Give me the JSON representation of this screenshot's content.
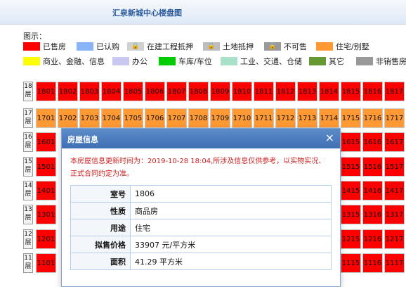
{
  "page_title": "汇泉新城中心楼盘图",
  "legend_label": "图示：",
  "legend": [
    {
      "label": "已售房",
      "color": "#ff0000",
      "icon": ""
    },
    {
      "label": "已认购",
      "color": "#8ab4f8",
      "icon": ""
    },
    {
      "label": "在建工程抵押",
      "color": "#d0d0d0",
      "icon": "lock-icon"
    },
    {
      "label": "土地抵押",
      "color": "#bdbdbd",
      "icon": "lock-icon"
    },
    {
      "label": "不可售",
      "color": "#9a9a9a",
      "icon": "lock-icon"
    },
    {
      "label": "住宅/别墅",
      "color": "#ff9933",
      "icon": ""
    },
    {
      "label": "商业、金融、信息",
      "color": "#ffff00",
      "icon": ""
    },
    {
      "label": "办公",
      "color": "#c8c8f0",
      "icon": ""
    },
    {
      "label": "车库/车位",
      "color": "#00cc00",
      "icon": ""
    },
    {
      "label": "工业、交通、仓储",
      "color": "#a8e0c8",
      "icon": ""
    },
    {
      "label": "其它",
      "color": "#669933",
      "icon": ""
    },
    {
      "label": "非销售房",
      "color": "#999999",
      "icon": ""
    }
  ],
  "floors": [
    {
      "label": "18层",
      "status": "sold",
      "units": [
        "1801",
        "1802",
        "1803",
        "1804",
        "1805",
        "1806",
        "1807",
        "1808",
        "1809",
        "1810",
        "1811",
        "1812",
        "1813",
        "1814",
        "1815",
        "1816",
        "1817"
      ]
    },
    {
      "label": "17层",
      "status": "home",
      "units": [
        "1701",
        "1702",
        "1703",
        "1704",
        "1705",
        "1706",
        "1707",
        "1708",
        "1709",
        "1710",
        "1711",
        "1712",
        "1713",
        "1714",
        "1715",
        "1716",
        "1717"
      ]
    },
    {
      "label": "16层",
      "status": "sold",
      "units": [
        "1601",
        "",
        "",
        "",
        "",
        "",
        "",
        "",
        "",
        "",
        "",
        "",
        "",
        "",
        "1615",
        "1616",
        "1617"
      ]
    },
    {
      "label": "15层",
      "status": "sold",
      "units": [
        "1501",
        "",
        "",
        "",
        "",
        "",
        "",
        "",
        "",
        "",
        "",
        "",
        "",
        "",
        "1515",
        "1516",
        "1517"
      ]
    },
    {
      "label": "14层",
      "status": "sold",
      "units": [
        "1401",
        "",
        "",
        "",
        "",
        "",
        "",
        "",
        "",
        "",
        "",
        "",
        "",
        "",
        "1415",
        "1416",
        "1417"
      ]
    },
    {
      "label": "13层",
      "status": "sold",
      "units": [
        "1301",
        "",
        "",
        "",
        "",
        "",
        "",
        "",
        "",
        "",
        "",
        "",
        "",
        "",
        "1315",
        "1316",
        "1317"
      ]
    },
    {
      "label": "12层",
      "status": "sold",
      "units": [
        "1201",
        "",
        "",
        "",
        "",
        "",
        "",
        "",
        "",
        "",
        "",
        "",
        "",
        "",
        "1215",
        "1216",
        "1217"
      ]
    },
    {
      "label": "11层",
      "status": "sold",
      "units": [
        "1101",
        "",
        "",
        "",
        "",
        "",
        "",
        "",
        "",
        "",
        "",
        "",
        "",
        "",
        "1115",
        "1116",
        "1117"
      ]
    }
  ],
  "dialog": {
    "title": "房屋信息",
    "close": "×",
    "notice": "本房屋信息更新时间为：2019-10-28 18:04,所涉及信息仅供参考，以实物实况、正式合同约定为准。",
    "rows": [
      {
        "key": "室号",
        "value": "1806"
      },
      {
        "key": "性质",
        "value": "商品房"
      },
      {
        "key": "用途",
        "value": "住宅"
      },
      {
        "key": "拟售价格",
        "value": "33907 元/平方米"
      },
      {
        "key": "面积",
        "value": "41.29 平方米"
      }
    ]
  }
}
